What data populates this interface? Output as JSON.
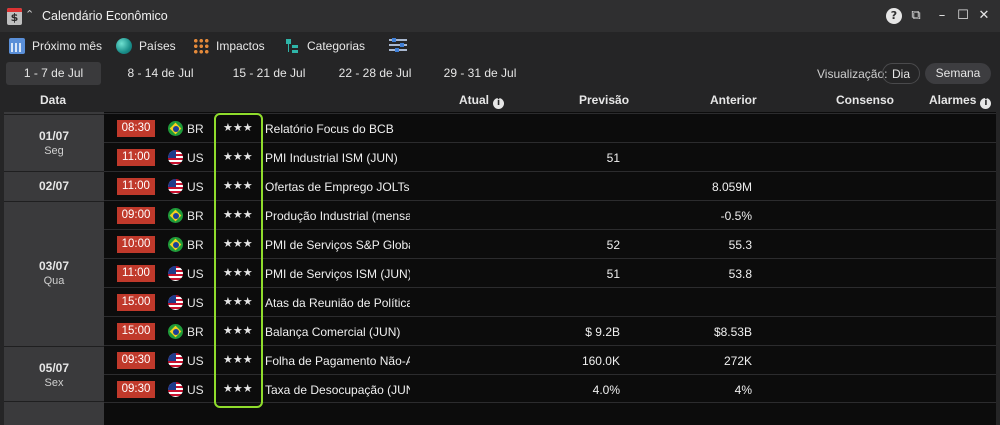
{
  "window": {
    "title": "Calendário Econômico",
    "app_icon_glyph": "$"
  },
  "toolbar": {
    "next_month": "Próximo mês",
    "countries": "Países",
    "impacts": "Impactos",
    "categories": "Categorias"
  },
  "weeks": [
    "1 - 7 de Jul",
    "8 - 14 de Jul",
    "15 - 21 de Jul",
    "22 - 28 de Jul",
    "29 - 31 de Jul"
  ],
  "active_week": 0,
  "view": {
    "label": "Visualização:",
    "day": "Dia",
    "week": "Semana",
    "selected": "Semana"
  },
  "columns": {
    "date": "Data",
    "actual": "Atual",
    "forecast": "Previsão",
    "previous": "Anterior",
    "consensus": "Consenso",
    "alarms": "Alarmes"
  },
  "dates": [
    {
      "date": "01/07",
      "weekday": "Seg"
    },
    {
      "date": "02/07",
      "weekday": ""
    },
    {
      "date": "03/07",
      "weekday": "Qua"
    },
    {
      "date": "05/07",
      "weekday": "Sex"
    }
  ],
  "events": [
    {
      "time": "08:30",
      "country": "BR",
      "stars": "★★★",
      "event": "Relatório Focus do BCB",
      "forecast": "",
      "previous": ""
    },
    {
      "time": "11:00",
      "country": "US",
      "stars": "★★★",
      "event": "PMI Industrial ISM (JUN)",
      "forecast": "51",
      "previous": ""
    },
    {
      "time": "11:00",
      "country": "US",
      "stars": "★★★",
      "event": "Ofertas de Emprego JOLTs (M",
      "forecast": "",
      "previous": "8.059M"
    },
    {
      "time": "09:00",
      "country": "BR",
      "stars": "★★★",
      "event": "Produção Industrial (mensal)",
      "forecast": "",
      "previous": "-0.5%"
    },
    {
      "time": "10:00",
      "country": "BR",
      "stars": "★★★",
      "event": "PMI de Serviços S&P Global",
      "forecast": "52",
      "previous": "55.3"
    },
    {
      "time": "11:00",
      "country": "US",
      "stars": "★★★",
      "event": "PMI de Serviços ISM (JUN)",
      "forecast": "51",
      "previous": "53.8"
    },
    {
      "time": "15:00",
      "country": "US",
      "stars": "★★★",
      "event": "Atas da Reunião de Política M",
      "forecast": "",
      "previous": ""
    },
    {
      "time": "15:00",
      "country": "BR",
      "stars": "★★★",
      "event": "Balança Comercial (JUN)",
      "forecast": "$ 9.2B",
      "previous": "$8.53B"
    },
    {
      "time": "09:30",
      "country": "US",
      "stars": "★★★",
      "event": "Folha de Pagamento Não-Ag",
      "forecast": "160.0K",
      "previous": "272K"
    },
    {
      "time": "09:30",
      "country": "US",
      "stars": "★★★",
      "event": "Taxa de Desocupação (JUN)",
      "forecast": "4.0%",
      "previous": "4%"
    }
  ],
  "colors": {
    "time_badge": "#c0392b",
    "highlight": "#8fdc2c",
    "active_tab": "#3a3a3c"
  }
}
